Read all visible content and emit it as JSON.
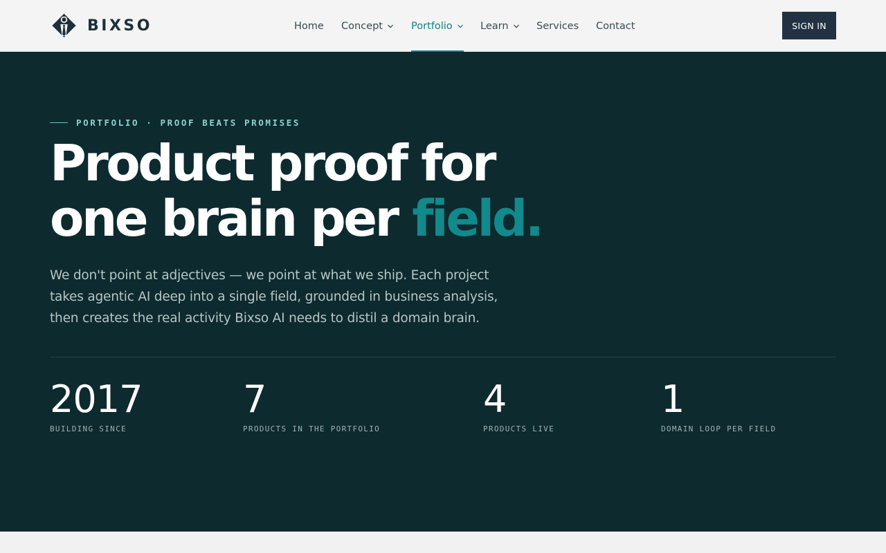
{
  "brand": {
    "name": "BIXSO",
    "logo_icon": "bixso-logo-icon"
  },
  "nav": {
    "items": [
      {
        "label": "Home",
        "dropdown": false
      },
      {
        "label": "Concept",
        "dropdown": true
      },
      {
        "label": "Portfolio",
        "dropdown": true,
        "active": true
      },
      {
        "label": "Learn",
        "dropdown": true
      },
      {
        "label": "Services",
        "dropdown": false
      },
      {
        "label": "Contact",
        "dropdown": false
      }
    ],
    "signin_label": "SIGN IN"
  },
  "hero": {
    "eyebrow": "PORTFOLIO · PROOF BEATS PROMISES",
    "headline_line1": "Product proof for",
    "headline_line2_prefix": "one brain per",
    "headline_accent": "field.",
    "lede": "We don't point at adjectives — we point at what we ship. Each project takes agentic AI deep into a single field, grounded in business analysis, then creates the real activity Bixso AI needs to distil a domain brain.",
    "stats": [
      {
        "value": "2017",
        "label": "BUILDING SINCE"
      },
      {
        "value": "7",
        "label": "PRODUCTS IN THE PORTFOLIO"
      },
      {
        "value": "4",
        "label": "PRODUCTS LIVE"
      },
      {
        "value": "1",
        "label": "DOMAIN LOOP PER FIELD"
      }
    ]
  },
  "colors": {
    "hero_bg": "#0d2a2f",
    "accent": "#118386",
    "signin_bg": "#223242",
    "header_bg": "#f3f4f3"
  }
}
